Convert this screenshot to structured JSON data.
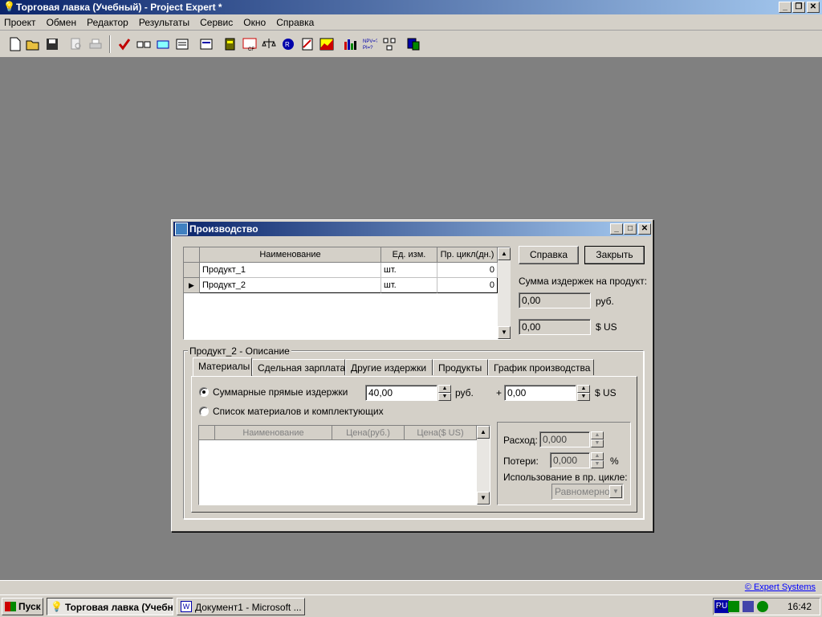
{
  "window": {
    "title": "Торговая лавка (Учебный) - Project Expert *"
  },
  "menu": [
    "Проект",
    "Обмен",
    "Редактор",
    "Результаты",
    "Сервис",
    "Окно",
    "Справка"
  ],
  "statusbar": {
    "link": "© Expert Systems"
  },
  "taskbar": {
    "start": "Пуск",
    "tasks": [
      "Торговая лавка (Учебный)...",
      "Документ1 - Microsoft ..."
    ],
    "lang": "RU",
    "clock": "16:42"
  },
  "dialog": {
    "title": "Производство",
    "grid": {
      "columns": [
        "Наименование",
        "Ед. изм.",
        "Пр. цикл(дн.)"
      ],
      "rows": [
        {
          "name": "Продукт_1",
          "unit": "шт.",
          "cycle": "0"
        },
        {
          "name": "Продукт_2",
          "unit": "шт.",
          "cycle": "0"
        }
      ]
    },
    "buttons": {
      "help": "Справка",
      "close": "Закрыть"
    },
    "cost_label": "Сумма издержек на продукт:",
    "cost_rub": "0,00",
    "cost_rub_unit": "руб.",
    "cost_usd": "0,00",
    "cost_usd_unit": "$ US",
    "group_title": "Продукт_2 - Описание",
    "tabs": [
      "Материалы",
      "Сдельная зарплата",
      "Другие издержки",
      "Продукты",
      "График производства"
    ],
    "radio_total": "Суммарные прямые издержки",
    "total_value": "40,00",
    "total_unit": "руб.",
    "plus": "+",
    "total_usd": "0,00",
    "total_usd_unit": "$ US",
    "radio_list": "Список материалов и комплектующих",
    "mat_columns": [
      "Наименование",
      "Цена(руб.)",
      "Цена($ US)"
    ],
    "usage": {
      "expense_label": "Расход:",
      "expense": "0,000",
      "loss_label": "Потери:",
      "loss": "0,000",
      "percent": "%",
      "cycle_label": "Использование в пр. цикле:",
      "cycle_value": "Равномерно"
    }
  }
}
